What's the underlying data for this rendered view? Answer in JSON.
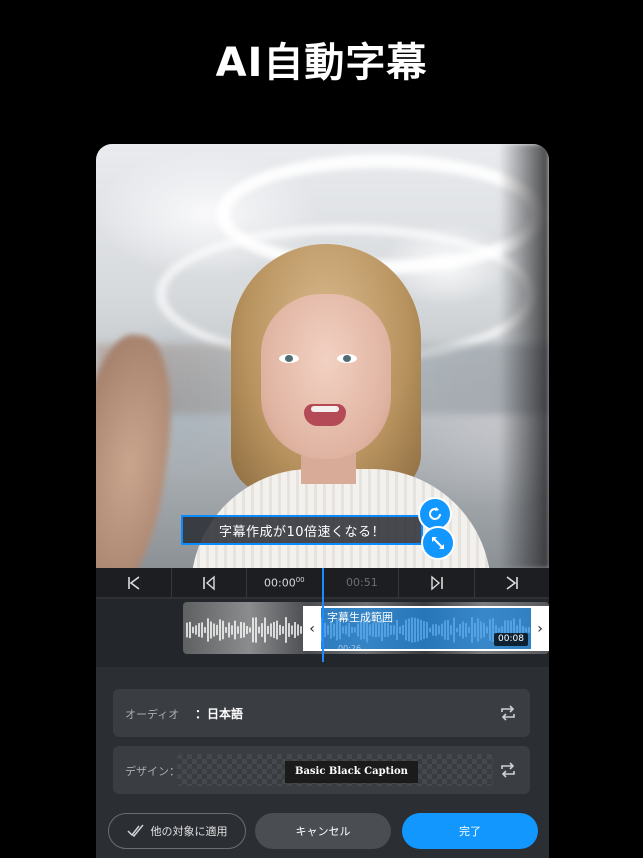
{
  "headline": "AI自動字幕",
  "preview": {
    "caption_text": "字幕作成が10倍速くなる！"
  },
  "transport": {
    "time_current_main": "00:00",
    "time_current_frac": "00",
    "time_end": "00:51"
  },
  "timeline": {
    "range_label": "字幕生成範囲",
    "range_duration": "00:08",
    "range_start": "00:26"
  },
  "settings": {
    "audio_label": "オーディオ",
    "audio_value": "：日本語",
    "design_label": "デザイン：",
    "design_style": "Basic Black Caption"
  },
  "buttons": {
    "apply_others": "他の対象に適用",
    "cancel": "キャンセル",
    "done": "完了"
  },
  "colors": {
    "accent": "#1297ff",
    "background": "#000000",
    "panel": "#2b2e33"
  }
}
